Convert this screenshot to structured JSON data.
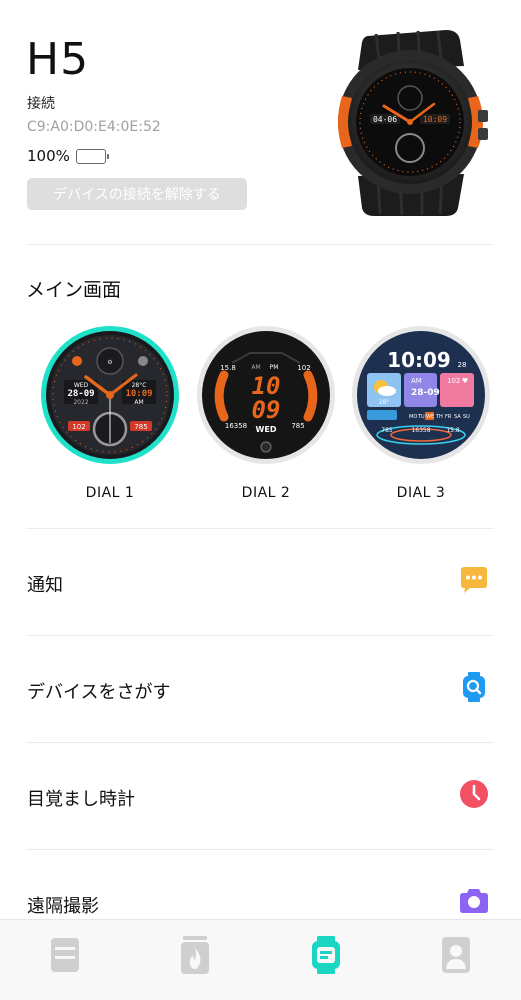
{
  "device": {
    "name": "H5",
    "status": "接続",
    "mac": "C9:A0:D0:E4:0E:52",
    "battery": "100%",
    "battery_level": 1.0,
    "disconnect_label": "デバイスの接続を解除する"
  },
  "main_screen": {
    "title": "メイン画面",
    "dials": [
      {
        "label": "DIAL 1",
        "face_text": [
          "WED",
          "28-09",
          "2022",
          "10:09",
          "AM",
          "28°C",
          "102",
          "785"
        ]
      },
      {
        "label": "DIAL 2",
        "face_text": [
          "15.8",
          "AM",
          "PM",
          "102",
          "10",
          "09",
          "16358",
          "WED",
          "785"
        ]
      },
      {
        "label": "DIAL 3",
        "face_text": [
          "10:09",
          "28",
          "AM",
          "28-09",
          "28°",
          "102",
          "MO",
          "TU",
          "WE",
          "TH",
          "FR",
          "SA",
          "SU",
          "785",
          "16358",
          "15.8"
        ]
      }
    ]
  },
  "menu": [
    {
      "label": "通知",
      "icon": "chat-bubble-icon",
      "color": "#f6b73c"
    },
    {
      "label": "デバイスをさがす",
      "icon": "find-watch-icon",
      "color": "#1e9bf0"
    },
    {
      "label": "目覚まし時計",
      "icon": "clock-icon",
      "color": "#f25063"
    },
    {
      "label": "遠隔撮影",
      "icon": "camera-icon",
      "color": "#8c63f2"
    }
  ],
  "tabbar": {
    "accent": "#1bd6c2",
    "inactive": "#cfcfcf",
    "tabs": [
      {
        "icon": "records-icon",
        "active": false
      },
      {
        "icon": "fire-icon",
        "active": false
      },
      {
        "icon": "watch-icon",
        "active": true
      },
      {
        "icon": "profile-icon",
        "active": false
      }
    ]
  }
}
